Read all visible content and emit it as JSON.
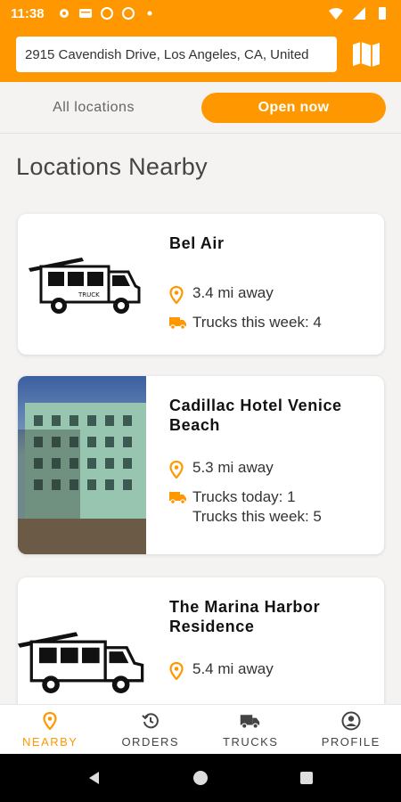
{
  "status_bar": {
    "time": "11:38"
  },
  "search": {
    "address": "2915 Cavendish Drive, Los Angeles, CA, United"
  },
  "filter": {
    "all_label": "All locations",
    "open_label": "Open now"
  },
  "section_title": "Locations Nearby",
  "locations": [
    {
      "name": "Bel Air",
      "distance": "3.4 mi away",
      "trucks_today": "",
      "trucks_week": "Trucks this week: 4"
    },
    {
      "name": "Cadillac Hotel Venice Beach",
      "distance": "5.3 mi away",
      "trucks_today": "Trucks today: 1",
      "trucks_week": "Trucks this week: 5"
    },
    {
      "name": "The Marina Harbor Residence",
      "distance": "5.4 mi away",
      "trucks_today": "",
      "trucks_week": ""
    }
  ],
  "bottom_nav": [
    {
      "label": "NEARBY",
      "icon": "location-pin-icon",
      "active": true
    },
    {
      "label": "ORDERS",
      "icon": "history-icon",
      "active": false
    },
    {
      "label": "TRUCKS",
      "icon": "truck-icon",
      "active": false
    },
    {
      "label": "PROFILE",
      "icon": "person-icon",
      "active": false
    }
  ],
  "colors": {
    "accent": "#ff9800",
    "background": "#f4f3f2"
  }
}
